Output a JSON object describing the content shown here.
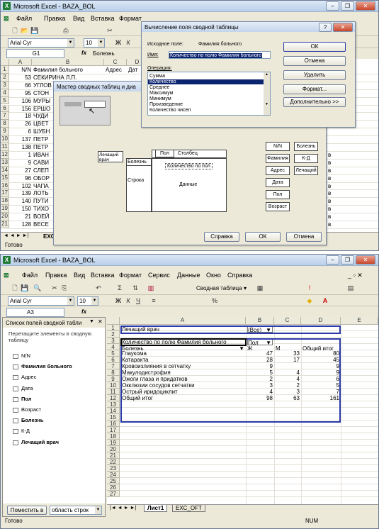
{
  "top": {
    "title": "Microsoft Excel - BAZA_BOL",
    "menu": [
      "Файл",
      "Правка",
      "Вид",
      "Вставка",
      "Формат",
      "Сервис",
      "Данные",
      "Окно",
      "Справка"
    ],
    "font_name": "Arial Cyr",
    "font_size": "10",
    "cell_ref": "G1",
    "formula": "Болезнь",
    "col_headers": [
      "A",
      "B",
      "C",
      "D"
    ],
    "rows": [
      {
        "n": "1",
        "a": "N/N",
        "b": "Фамилия больного",
        "c": "Адрес",
        "d": "Дат"
      },
      {
        "n": "2",
        "a": "53",
        "b": "СЕКИРИНА Л.П."
      },
      {
        "n": "3",
        "a": "66",
        "b": "УГЛОВ"
      },
      {
        "n": "4",
        "a": "95",
        "b": "СТОН"
      },
      {
        "n": "5",
        "a": "106",
        "b": "МУРЫ"
      },
      {
        "n": "6",
        "a": "156",
        "b": "ЕРШО"
      },
      {
        "n": "7",
        "a": "18",
        "b": "ЧУДИ"
      },
      {
        "n": "8",
        "a": "26",
        "b": "ЦВЕТ"
      },
      {
        "n": "9",
        "a": "6",
        "b": "ШУБН"
      },
      {
        "n": "10",
        "a": "137",
        "b": "ПЕТР"
      },
      {
        "n": "11",
        "a": "138",
        "b": "ПЕТР"
      },
      {
        "n": "12",
        "a": "1",
        "b": "ИВАН"
      },
      {
        "n": "13",
        "a": "9",
        "b": "САВИ"
      },
      {
        "n": "14",
        "a": "27",
        "b": "СЛЕП"
      },
      {
        "n": "15",
        "a": "96",
        "b": "ОБОР"
      },
      {
        "n": "16",
        "a": "102",
        "b": "ЧАПА"
      },
      {
        "n": "17",
        "a": "139",
        "b": "ЛОТЬ"
      },
      {
        "n": "18",
        "a": "140",
        "b": "ПУТИ"
      },
      {
        "n": "19",
        "a": "150",
        "b": "ТИХО"
      },
      {
        "n": "20",
        "a": "21",
        "b": "ВОЕЙ"
      },
      {
        "n": "21",
        "a": "128",
        "b": "ВЕСЕ"
      }
    ],
    "right_column_letter": "в",
    "sheet_tab_fragment": "EXC",
    "status": "Готово",
    "wizard": {
      "title": "Мастер сводных таблиц и диа",
      "page_label": "Лечащий врач",
      "column_label": "Пол",
      "column_area": "Столбец",
      "row_field": "Болезнь",
      "row_area": "Строка",
      "data_field": "Количество по пол",
      "data_area": "Данные",
      "fields": [
        "N/N",
        "Болезнь",
        "Фамилия",
        "К-Д",
        "Адрес",
        "Лечащий",
        "Дата",
        "Пол",
        "Возраст"
      ],
      "buttons": {
        "help": "Справка",
        "ok": "ОК",
        "cancel": "Отмена"
      }
    },
    "calc": {
      "title": "Вычисление поля сводной таблицы",
      "source_label": "Исходное поле:",
      "source_value": "Фамилия больного",
      "name_label": "Имя:",
      "name_value": "Количество по полю Фамилия больного",
      "op_label": "Операция:",
      "operations": [
        "Сумма",
        "Количество",
        "Среднее",
        "Максимум",
        "Минимум",
        "Произведение",
        "Количество чисел"
      ],
      "selected_op": "Количество",
      "buttons": {
        "ok": "ОК",
        "cancel": "Отмена",
        "delete": "Удалить",
        "format": "Формат...",
        "more": "Дополнительно >>"
      }
    }
  },
  "bottom": {
    "title": "Microsoft Excel - BAZA_BOL",
    "menu": [
      "Файл",
      "Правка",
      "Вид",
      "Вставка",
      "Формат",
      "Сервис",
      "Данные",
      "Окно",
      "Справка"
    ],
    "pivot_menu": "Сводная таблица",
    "font_name": "Arial Cyr",
    "font_size": "10",
    "cell_ref": "A3",
    "formula": "",
    "panel": {
      "title": "Список полей сводной табли",
      "hint": "Перетащите элементы в сводную таблицу",
      "fields": [
        {
          "label": "N/N",
          "bold": false
        },
        {
          "label": "Фамилия больного",
          "bold": true
        },
        {
          "label": "Адрес",
          "bold": false
        },
        {
          "label": "Дата",
          "bold": false
        },
        {
          "label": "Пол",
          "bold": true
        },
        {
          "label": "Возраст",
          "bold": false
        },
        {
          "label": "Болезнь",
          "bold": true
        },
        {
          "label": "К-Д",
          "bold": false
        },
        {
          "label": "Лечащий врач",
          "bold": true
        }
      ],
      "place_button": "Поместить в",
      "area_select": "область строк"
    },
    "col_headers": [
      "A",
      "B",
      "C",
      "D",
      "E"
    ],
    "row_numbers": [
      "1",
      "2",
      "3",
      "4",
      "5",
      "6",
      "7",
      "8",
      "9",
      "10",
      "11",
      "12",
      "13",
      "14",
      "15",
      "16",
      "17",
      "18",
      "19",
      "20",
      "21",
      "22",
      "23",
      "24",
      "25",
      "26",
      "27"
    ],
    "pivot": {
      "page_field": "Лечащий врач",
      "page_value": "(Все)",
      "data_caption": "Количество по полю Фамилия больного",
      "col_field": "Пол",
      "row_field": "Болезнь",
      "col_items": [
        "Ж",
        "М",
        "Общий итог"
      ],
      "rows": [
        {
          "label": "Глаукома",
          "zh": "47",
          "m": "33",
          "total": "80"
        },
        {
          "label": "Катаракта",
          "zh": "28",
          "m": "17",
          "total": "45"
        },
        {
          "label": "Кровоизлияния в сетчатку",
          "zh": "9",
          "m": "",
          "total": "9"
        },
        {
          "label": "Макулодистрофия",
          "zh": "5",
          "m": "4",
          "total": "9"
        },
        {
          "label": "Ожоги глаза и придатков",
          "zh": "2",
          "m": "4",
          "total": "6"
        },
        {
          "label": "Окклюзии сосудов сетчатки",
          "zh": "3",
          "m": "2",
          "total": "5"
        },
        {
          "label": "Острый иридоциклит",
          "zh": "4",
          "m": "3",
          "total": "7"
        }
      ],
      "grand": {
        "label": "Общий итог",
        "zh": "98",
        "m": "63",
        "total": "161"
      }
    },
    "tabs": [
      "Лист1",
      "EXC_OFT"
    ],
    "status": "Готово",
    "num": "NUM"
  }
}
